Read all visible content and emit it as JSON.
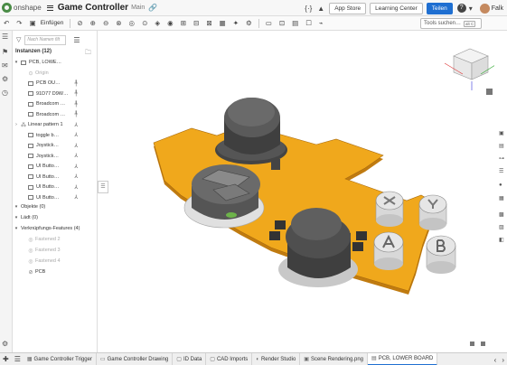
{
  "app": {
    "logo_text": "onshape",
    "doc_title": "Game Controller",
    "branch": "Main"
  },
  "header": {
    "app_store": "App Store",
    "learning_center": "Learning Center",
    "share": "Teilen",
    "help": "?",
    "username": "Falk"
  },
  "toolbar": {
    "insert_label": "Einfügen",
    "search_placeholder": "Tools suchen…",
    "search_shortcut": "alt C"
  },
  "panel": {
    "filter_placeholder": "Nach Namen filt",
    "instances_header": "Instanzen (12)",
    "items": [
      {
        "label": "PCB, LOWE…",
        "style": "root"
      },
      {
        "label": "Origin",
        "style": "grey"
      },
      {
        "label": "PCB OU…",
        "style": "part"
      },
      {
        "label": "91D77 D9W…",
        "style": "part"
      },
      {
        "label": "Broadcom …",
        "style": "part"
      },
      {
        "label": "Broadcom …",
        "style": "part"
      },
      {
        "label": "Linear pattern 1",
        "style": "pattern"
      },
      {
        "label": "toggle b…",
        "style": "part"
      },
      {
        "label": "Joystick…",
        "style": "part"
      },
      {
        "label": "Joystick…",
        "style": "part"
      },
      {
        "label": "UI Butto…",
        "style": "part"
      },
      {
        "label": "UI Butto…",
        "style": "part"
      },
      {
        "label": "UI Butto…",
        "style": "part"
      },
      {
        "label": "UI Butto…",
        "style": "part"
      }
    ],
    "objects": "Objekte (0)",
    "loads": "Lädt (0)",
    "mate_features": "Verknüpfungs-Features (4)",
    "fastened": [
      "Fastened 2",
      "Fastened 3",
      "Fastened 4"
    ],
    "pcb": "PCB"
  },
  "tabs": [
    {
      "label": "Game Controller Trigger",
      "icon": "part-studio-icon"
    },
    {
      "label": "Game Controller Drawing",
      "icon": "drawing-icon"
    },
    {
      "label": "ID Data",
      "icon": "folder-icon"
    },
    {
      "label": "CAD Imports",
      "icon": "folder-icon"
    },
    {
      "label": "Render Studio",
      "icon": "render-icon"
    },
    {
      "label": "Scene Rendering.png",
      "icon": "image-icon"
    },
    {
      "label": "PCB, LOWER BOARD",
      "icon": "assembly-icon",
      "active": true
    }
  ],
  "colors": {
    "board": "#f0a81c",
    "board_edge": "#c07b10",
    "joystick": "#4a4a4a",
    "share_blue": "#1f6fd1",
    "brand_green": "#4a8c46"
  }
}
